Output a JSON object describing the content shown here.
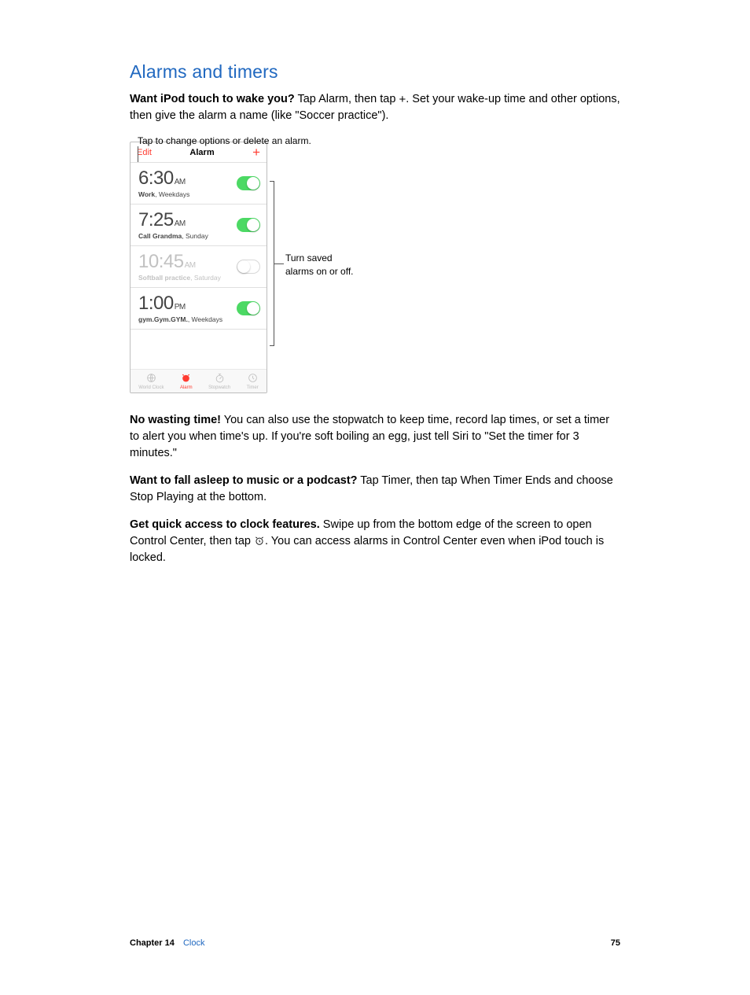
{
  "section_title": "Alarms and timers",
  "para1": {
    "bold": "Want iPod touch to wake you?",
    "rest_a": " Tap Alarm, then tap ",
    "plus": "+",
    "rest_b": ". Set your wake-up time and other options, then give the alarm a name (like \"Soccer practice\")."
  },
  "figure": {
    "callout_top": "Tap to change options or delete an alarm.",
    "callout_right_line1": "Turn saved",
    "callout_right_line2": "alarms on or off.",
    "header": {
      "edit": "Edit",
      "title": "Alarm",
      "add": "+"
    },
    "alarms": [
      {
        "time": "6:30",
        "ampm": "AM",
        "label_bold": "Work",
        "label_rest": ", Weekdays",
        "on": true
      },
      {
        "time": "7:25",
        "ampm": "AM",
        "label_bold": "Call Grandma",
        "label_rest": ", Sunday",
        "on": true
      },
      {
        "time": "10:45",
        "ampm": "AM",
        "label_bold": "Softball practice",
        "label_rest": ", Saturday",
        "on": false
      },
      {
        "time": "1:00",
        "ampm": "PM",
        "label_bold": "gym.Gym.GYM.",
        "label_rest": ", Weekdays",
        "on": true
      }
    ],
    "tabs": [
      {
        "name": "World Clock"
      },
      {
        "name": "Alarm"
      },
      {
        "name": "Stopwatch"
      },
      {
        "name": "Timer"
      }
    ]
  },
  "para2": {
    "bold": "No wasting time!",
    "rest": " You can also use the stopwatch to keep time, record lap times, or set a timer to alert you when time's up. If you're soft boiling an egg, just tell Siri to \"Set the timer for 3 minutes.\""
  },
  "para3": {
    "bold": "Want to fall asleep to music or a podcast?",
    "rest": " Tap Timer, then tap When Timer Ends and choose Stop Playing at the bottom."
  },
  "para4": {
    "bold": "Get quick access to clock features.",
    "rest_a": " Swipe up from the bottom edge of the screen to open Control Center, then tap ",
    "rest_b": ". You can access alarms in Control Center even when iPod touch is locked."
  },
  "footer": {
    "chapter_word": "Chapter",
    "chapter_num": "14",
    "chapter_name": "Clock",
    "page": "75"
  }
}
